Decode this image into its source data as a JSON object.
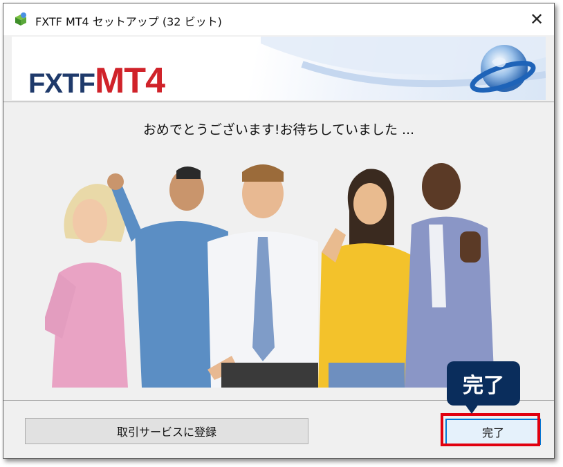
{
  "window": {
    "title": "FXTF MT4 セットアップ (32 ビット)",
    "close_glyph": "✕",
    "app_icon": "installer-box-icon"
  },
  "banner": {
    "logo_part1": "FXTF",
    "logo_part2": "MT4",
    "globe_icon": "globe-icon"
  },
  "main": {
    "message": "おめでとうございます!お待ちしていました ...",
    "illustration": "group-of-five-cheering-people"
  },
  "footer": {
    "register_label": "取引サービスに登録",
    "done_label": "完了"
  },
  "annotation": {
    "callout_label": "完了",
    "highlight_color": "#e1000f",
    "callout_color": "#0a2d5c"
  },
  "colors": {
    "logo_blue": "#1f3a6b",
    "logo_red": "#d0232a",
    "focus_blue": "#0078d7"
  }
}
